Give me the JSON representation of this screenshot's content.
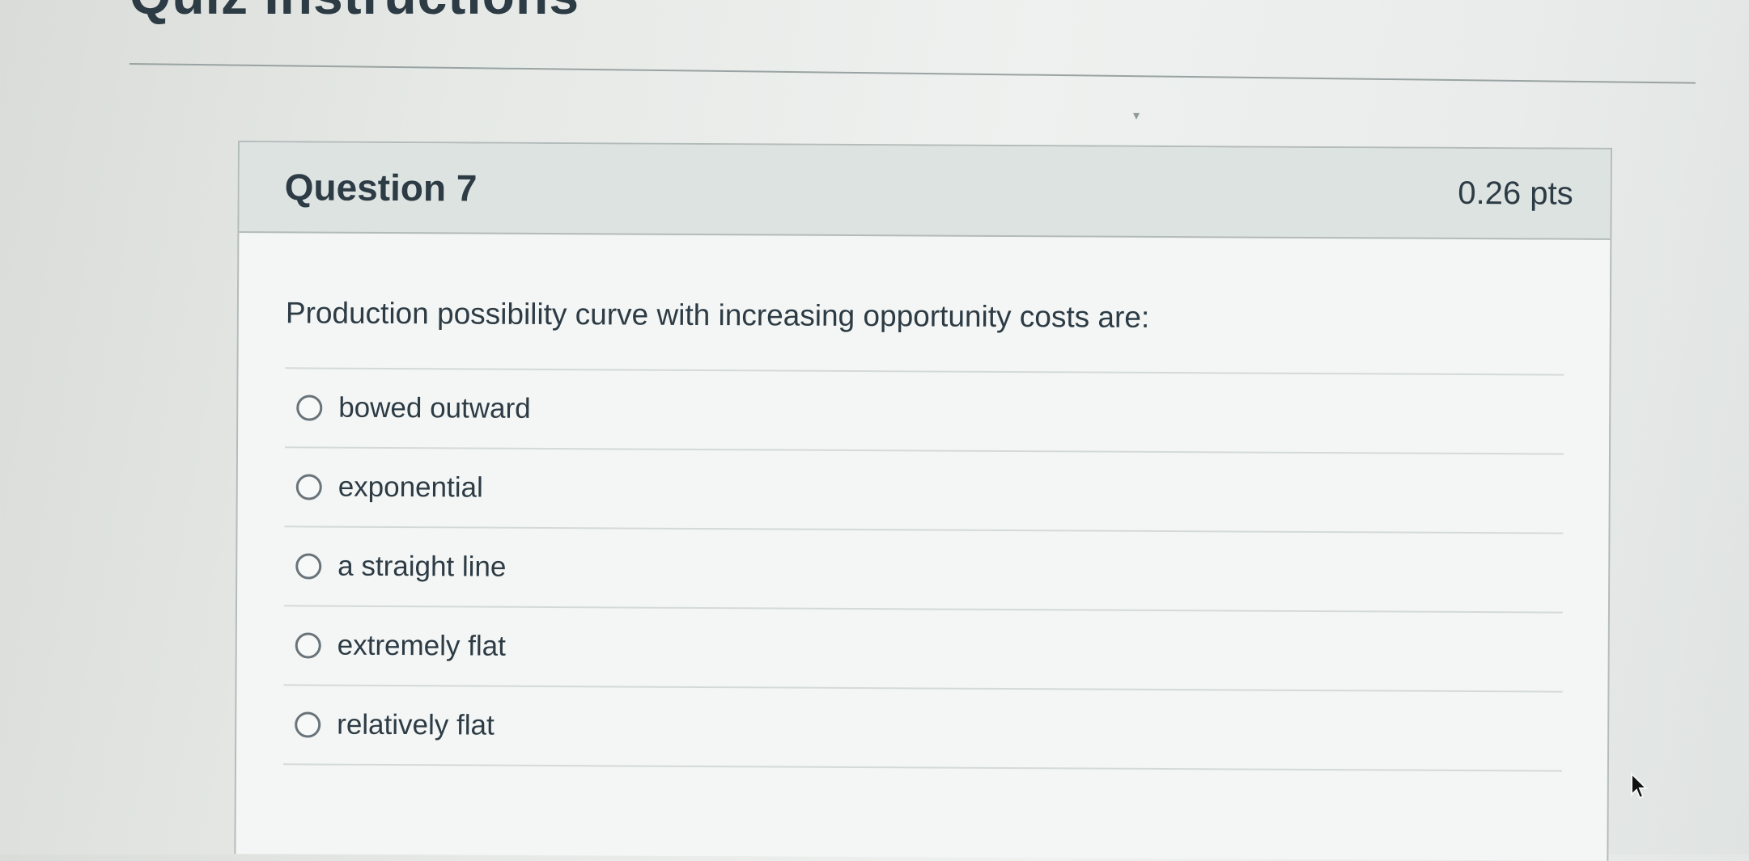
{
  "page": {
    "heading": "Quiz Instructions"
  },
  "question": {
    "title": "Question 7",
    "points": "0.26 pts",
    "text": "Production possibility curve with increasing opportunity costs are:",
    "options": [
      {
        "label": "bowed outward",
        "selected": false
      },
      {
        "label": "exponential",
        "selected": false
      },
      {
        "label": "a straight line",
        "selected": false
      },
      {
        "label": "extremely flat",
        "selected": false
      },
      {
        "label": "relatively flat",
        "selected": false
      }
    ]
  },
  "icons": {
    "cursor": "mouse-pointer-icon",
    "option_marker": "radio-circle-icon"
  },
  "colors": {
    "text": "#2d3b45",
    "header_background": "#dde3e1",
    "border": "#b4bbbb"
  }
}
